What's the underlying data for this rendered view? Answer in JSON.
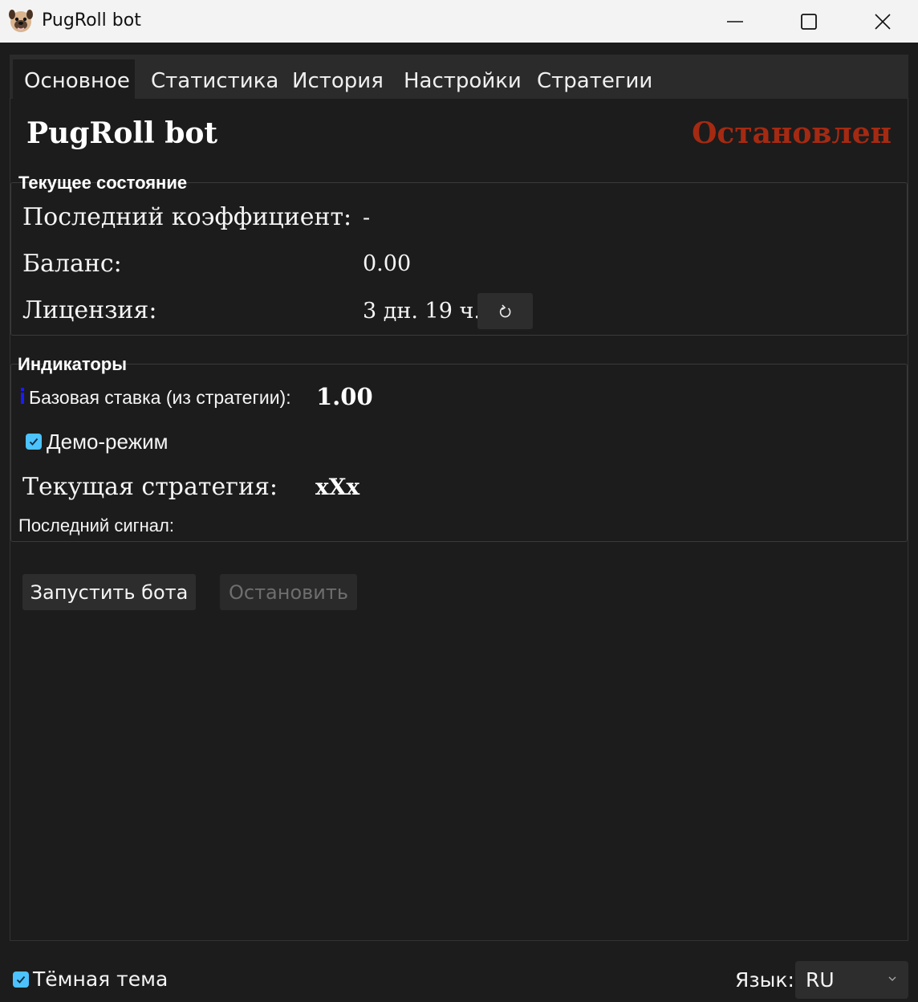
{
  "window": {
    "title": "PugRoll bot"
  },
  "tabs": [
    {
      "label": "Основное",
      "active": true
    },
    {
      "label": "Статистика",
      "active": false
    },
    {
      "label": "История",
      "active": false
    },
    {
      "label": "Настройки",
      "active": false
    },
    {
      "label": "Стратегии",
      "active": false
    }
  ],
  "header": {
    "title": "PugRoll bot",
    "status": "Остановлен",
    "status_color": "#a52a12"
  },
  "current_state": {
    "group_label": "Текущее состояние",
    "last_coef_label": "Последний коэффициент:",
    "last_coef_value": "-",
    "balance_label": "Баланс:",
    "balance_value": "0.00",
    "license_label": "Лицензия:",
    "license_value": "3 дн. 19 ч.",
    "refresh_icon": "refresh-icon"
  },
  "indicators": {
    "group_label": "Индикаторы",
    "base_bet_label": "Базовая ставка (из стратегии):",
    "base_bet_value": "1.00",
    "demo_label": "Демо-режим",
    "demo_checked": true,
    "strategy_label": "Текущая стратегия:",
    "strategy_value": "xXx",
    "last_signal_label": "Последний сигнал:"
  },
  "actions": {
    "start_label": "Запустить бота",
    "stop_label": "Остановить"
  },
  "footer": {
    "dark_theme_label": "Тёмная тема",
    "dark_theme_checked": true,
    "language_label": "Язык:",
    "language_value": "RU"
  },
  "colors": {
    "accent": "#4cc2ff",
    "background": "#1c1c1c",
    "info_icon": "#1a1aff"
  }
}
